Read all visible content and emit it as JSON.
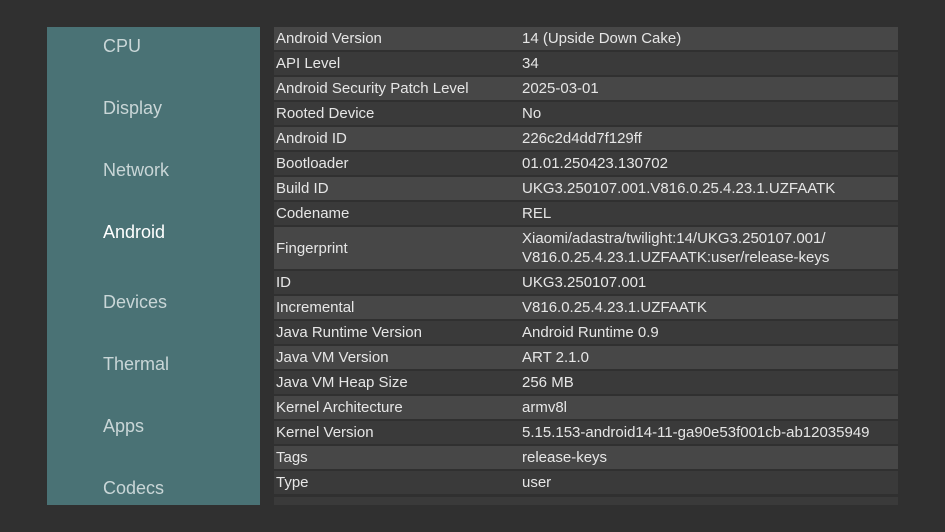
{
  "sidebar": {
    "items": [
      {
        "label": "CPU",
        "active": false
      },
      {
        "label": "Display",
        "active": false
      },
      {
        "label": "Network",
        "active": false
      },
      {
        "label": "Android",
        "active": true
      },
      {
        "label": "Devices",
        "active": false
      },
      {
        "label": "Thermal",
        "active": false
      },
      {
        "label": "Apps",
        "active": false
      },
      {
        "label": "Codecs",
        "active": false
      }
    ]
  },
  "details": {
    "rows": [
      {
        "key": "Android Version",
        "value": "14 (Upside Down Cake)"
      },
      {
        "key": "API Level",
        "value": "34"
      },
      {
        "key": "Android Security Patch Level",
        "value": "2025-03-01"
      },
      {
        "key": "Rooted Device",
        "value": "No"
      },
      {
        "key": "Android ID",
        "value": "226c2d4dd7f129ff"
      },
      {
        "key": "Bootloader",
        "value": "01.01.250423.130702"
      },
      {
        "key": "Build ID",
        "value": "UKG3.250107.001.V816.0.25.4.23.1.UZFAATK"
      },
      {
        "key": "Codename",
        "value": "REL"
      },
      {
        "key": "Fingerprint",
        "value": "Xiaomi/adastra/twilight:14/UKG3.250107.001/\nV816.0.25.4.23.1.UZFAATK:user/release-keys"
      },
      {
        "key": "ID",
        "value": "UKG3.250107.001"
      },
      {
        "key": "Incremental",
        "value": "V816.0.25.4.23.1.UZFAATK"
      },
      {
        "key": "Java Runtime Version",
        "value": "Android Runtime 0.9"
      },
      {
        "key": "Java VM Version",
        "value": "ART 2.1.0"
      },
      {
        "key": "Java VM Heap Size",
        "value": "256 MB"
      },
      {
        "key": "Kernel Architecture",
        "value": "armv8l"
      },
      {
        "key": "Kernel Version",
        "value": "5.15.153-android14-11-ga90e53f001cb-ab12035949"
      },
      {
        "key": "Tags",
        "value": "release-keys"
      },
      {
        "key": "Type",
        "value": "user"
      }
    ]
  }
}
